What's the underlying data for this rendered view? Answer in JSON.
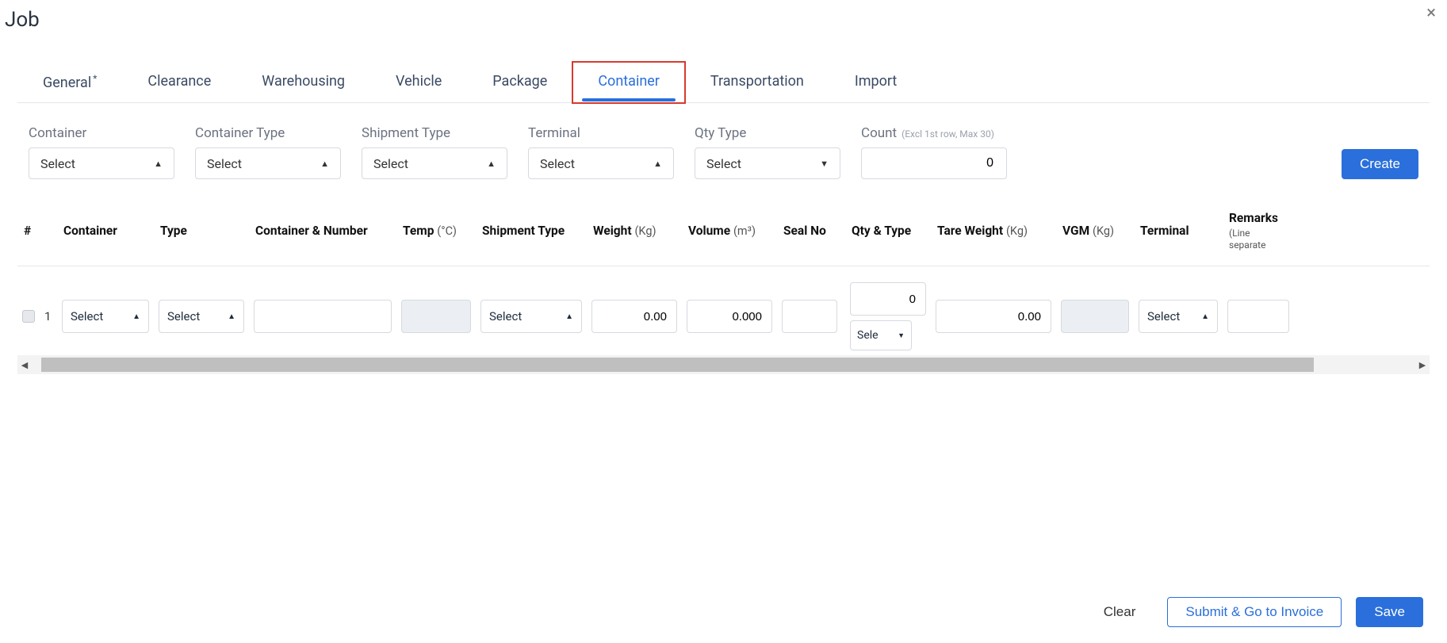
{
  "title": "Job",
  "tabs": [
    {
      "label": "General",
      "star": true
    },
    {
      "label": "Clearance"
    },
    {
      "label": "Warehousing"
    },
    {
      "label": "Vehicle"
    },
    {
      "label": "Package"
    },
    {
      "label": "Container",
      "active": true
    },
    {
      "label": "Transportation"
    },
    {
      "label": "Import"
    }
  ],
  "filters": {
    "container": {
      "label": "Container",
      "value": "Select"
    },
    "container_type": {
      "label": "Container Type",
      "value": "Select"
    },
    "shipment_type": {
      "label": "Shipment Type",
      "value": "Select"
    },
    "terminal": {
      "label": "Terminal",
      "value": "Select"
    },
    "qty_type": {
      "label": "Qty Type",
      "value": "Select"
    },
    "count": {
      "label": "Count",
      "hint": "(Excl 1st row, Max 30)",
      "value": "0"
    },
    "create_label": "Create"
  },
  "columns": {
    "idx": "#",
    "container": "Container",
    "type": "Type",
    "container_number": "Container & Number",
    "temp": "Temp",
    "temp_unit": "(°C)",
    "shipment_type": "Shipment Type",
    "weight": "Weight",
    "weight_unit": "(Kg)",
    "volume": "Volume",
    "volume_unit": "(m³)",
    "seal_no": "Seal No",
    "qty_type": "Qty & Type",
    "tare_weight": "Tare Weight",
    "tare_weight_unit": "(Kg)",
    "vgm": "VGM",
    "vgm_unit": "(Kg)",
    "terminal": "Terminal",
    "remarks": "Remarks",
    "remarks_sub": "(Line separate"
  },
  "rows": [
    {
      "idx": "1",
      "container": "Select",
      "type": "Select",
      "container_number": "",
      "temp": "",
      "shipment_type": "Select",
      "weight": "0.00",
      "volume": "0.000",
      "seal_no": "",
      "qty": "0",
      "qty_type": "Sele",
      "tare_weight": "0.00",
      "vgm": "",
      "terminal": "Select",
      "remarks": ""
    }
  ],
  "footer": {
    "clear": "Clear",
    "submit": "Submit & Go to Invoice",
    "save": "Save"
  }
}
